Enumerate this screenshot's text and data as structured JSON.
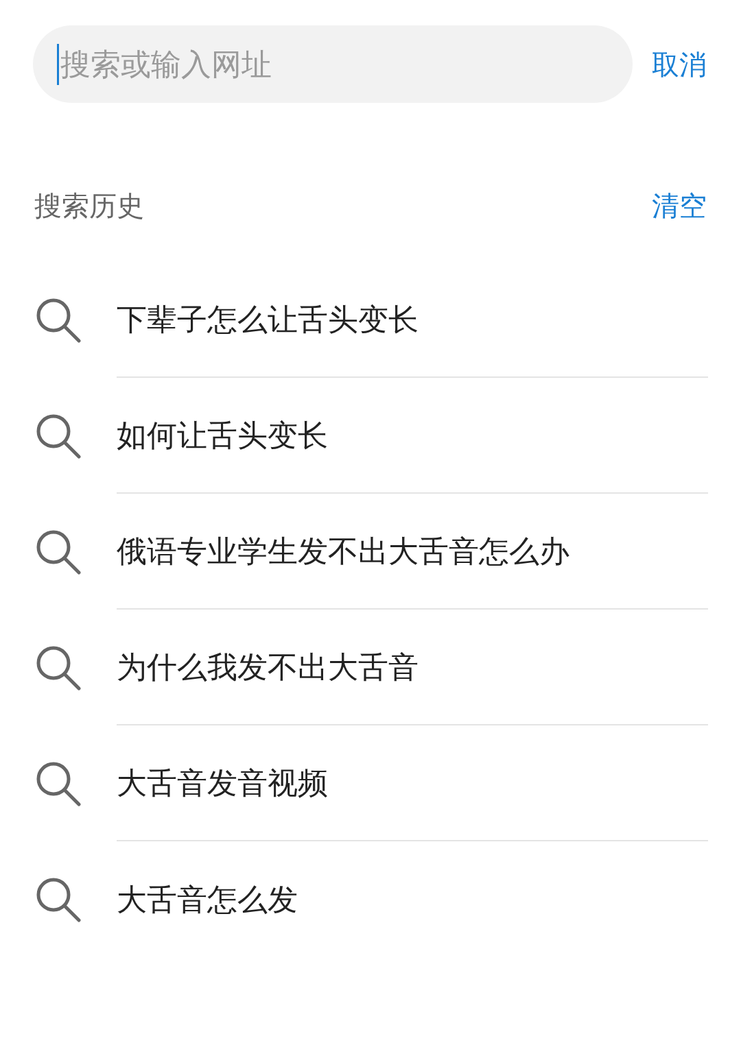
{
  "search": {
    "placeholder": "搜索或输入网址",
    "cancel": "取消"
  },
  "history": {
    "title": "搜索历史",
    "clear": "清空",
    "items": [
      {
        "text": "下辈子怎么让舌头变长"
      },
      {
        "text": "如何让舌头变长"
      },
      {
        "text": "俄语专业学生发不出大舌音怎么办"
      },
      {
        "text": "为什么我发不出大舌音"
      },
      {
        "text": "大舌音发音视频"
      },
      {
        "text": "大舌音怎么发"
      }
    ]
  }
}
